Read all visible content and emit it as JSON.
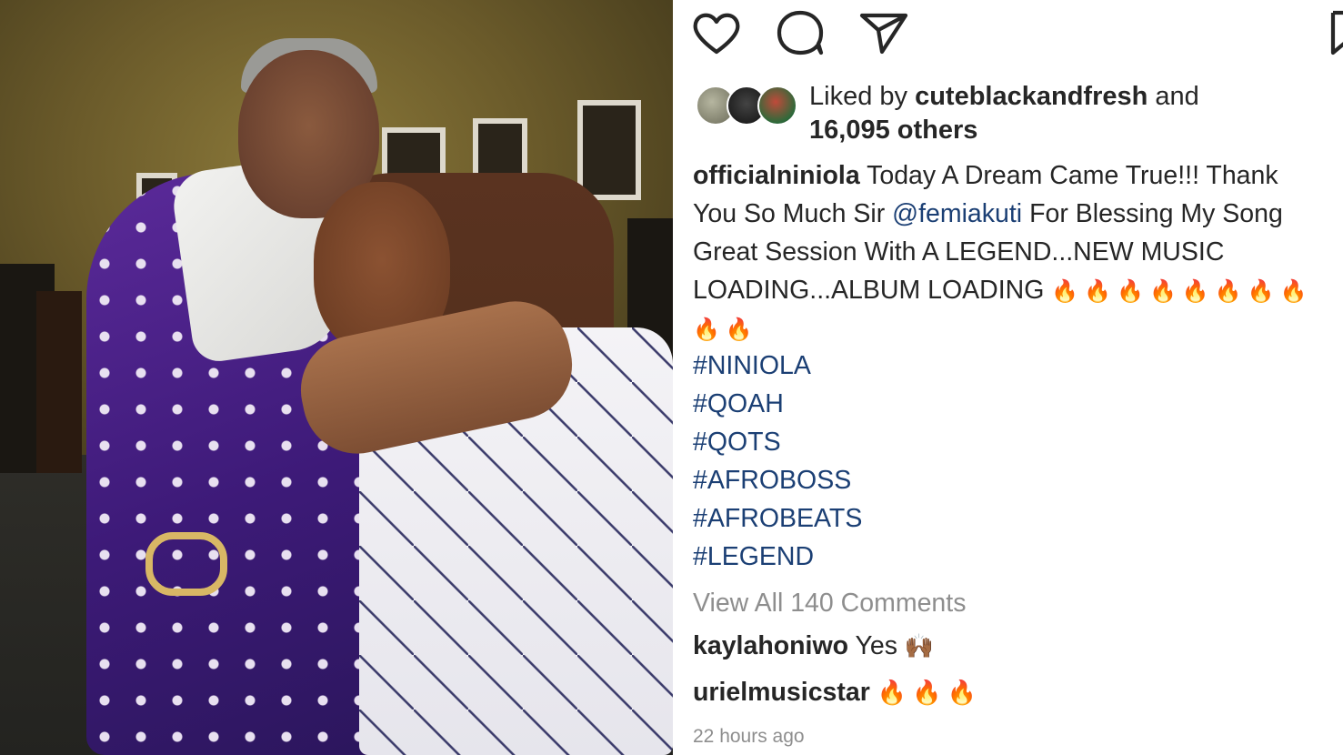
{
  "post": {
    "actions": {
      "like": "heart-icon",
      "comment": "comment-icon",
      "share": "send-icon",
      "save": "bookmark-icon"
    },
    "likes": {
      "prefix": "Liked by",
      "first_user": "cuteblackandfresh",
      "connector": "and",
      "others": "16,095 others"
    },
    "caption": {
      "username": "officialniniola",
      "line1_text": "Today A Dream Came True!!! Thank",
      "line2_pre": "You So Much Sir",
      "mention": "@femiakuti",
      "line2_post": "For Blessing My Song",
      "line3": "Great Session With A LEGEND...NEW MUSIC",
      "line4": "LOADING...ALBUM LOADING",
      "fires_line4": "🔥🔥🔥🔥🔥🔥🔥🔥",
      "fires_line5": "🔥🔥"
    },
    "hashtags": [
      "#NINIOLA",
      "#QOAH",
      "#QOTS",
      "#AFROBOSS",
      "#AFROBEATS",
      "#LEGEND"
    ],
    "view_all_comments": "View All 140 Comments",
    "comments": [
      {
        "user": "kaylahoniwo",
        "text": "Yes",
        "emoji": "🙌🏾"
      },
      {
        "user": "urielmusicstar",
        "text": "",
        "emoji": "🔥🔥🔥"
      }
    ],
    "timestamp": "22 hours ago"
  },
  "colors": {
    "text": "#262626",
    "link": "#1b3f74",
    "muted": "#8e8e8e",
    "robe": "#5b2a9a"
  }
}
